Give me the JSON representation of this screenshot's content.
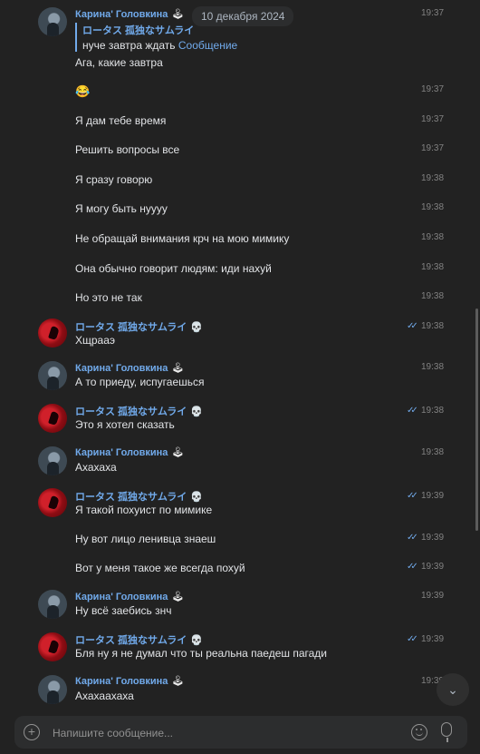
{
  "date_pill": "10 декабря 2024",
  "reply": {
    "name": "ロータス 孤独なサムライ",
    "text": "нуче завтра ждать",
    "link": "Сообщение"
  },
  "names": {
    "karina": "Карина' Головкина",
    "lotus": "ロータス 孤独なサムライ"
  },
  "name_emoji": {
    "karina": "🕹",
    "lotus": "💀"
  },
  "messages": [
    {
      "time": "19:37",
      "text": "Ага, какие завтра"
    },
    {
      "time": "19:37",
      "text": "😂"
    },
    {
      "time": "19:37",
      "text": "Я дам тебе время"
    },
    {
      "time": "19:37",
      "text": "Решить вопросы все"
    },
    {
      "time": "19:38",
      "text": "Я сразу говорю"
    },
    {
      "time": "19:38",
      "text": "Я могу быть нуууу"
    },
    {
      "time": "19:38",
      "text": "Не обращай внимания крч на мою мимику"
    },
    {
      "time": "19:38",
      "text": "Она обычно говорит людям: иди нахуй"
    },
    {
      "time": "19:38",
      "text": "Но это не так"
    },
    {
      "time": "19:38",
      "text": "Хщрааэ"
    },
    {
      "time": "19:38",
      "text": "А то приеду, испугаешься"
    },
    {
      "time": "19:38",
      "text": "Это я хотел сказать"
    },
    {
      "time": "19:38",
      "text": "Ахахаха"
    },
    {
      "time": "19:39",
      "text": "Я такой похуист по мимике"
    },
    {
      "time": "19:39",
      "text": "Ну вот лицо ленивца знаеш"
    },
    {
      "time": "19:39",
      "text": "Вот у меня такое же всегда похуй"
    },
    {
      "time": "19:39",
      "text": "Ну всё заебись знч"
    },
    {
      "time": "19:39",
      "text": "Бля ну я не думал что ты реальна паедеш пагади"
    },
    {
      "time": "19:39",
      "text": "Ахахаахаха"
    }
  ],
  "first_time": "19:37",
  "ticks": "✓✓",
  "composer": {
    "placeholder": "Напишите сообщение..."
  },
  "icons": {
    "plus": "+",
    "down": "⌄"
  }
}
